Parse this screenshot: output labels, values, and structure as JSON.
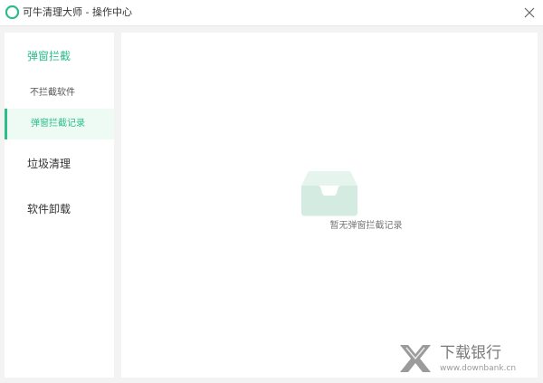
{
  "window": {
    "title": "可牛清理大师 - 操作中心"
  },
  "colors": {
    "accent": "#2ebd8a",
    "active_bg": "#eefbf5"
  },
  "icons": {
    "app": "kaniu-logo-icon",
    "close": "close-icon",
    "empty": "empty-inbox-icon",
    "watermark": "downbank-logo"
  },
  "sidebar": {
    "section_popup": "弹窗拦截",
    "item_not_blocked": "不拦截软件",
    "item_block_records": "弹窗拦截记录",
    "section_junk": "垃圾清理",
    "section_uninstall": "软件卸载"
  },
  "main": {
    "empty_message": "暂无弹窗拦截记录"
  },
  "watermark": {
    "name": "下载银行",
    "url": "www.downbank.cn"
  }
}
